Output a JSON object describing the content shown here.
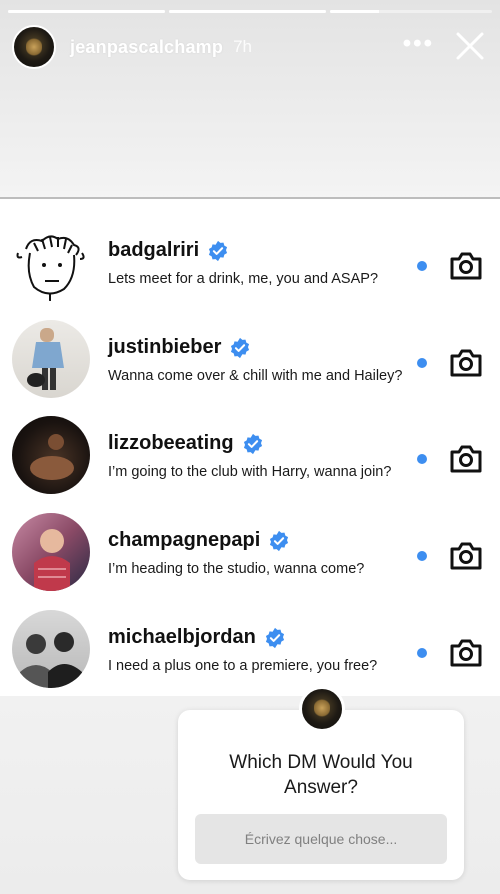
{
  "story": {
    "progress": [
      1.0,
      1.0,
      0.3
    ],
    "username": "jeanpascalchamp",
    "time": "7h",
    "more_label": "•••"
  },
  "dms": [
    {
      "username": "badgalriri",
      "verified": true,
      "message": "Lets meet for a drink, me, you and ASAP?",
      "unread": true,
      "avatar": "sketch-face"
    },
    {
      "username": "justinbieber",
      "verified": true,
      "message": "Wanna come over & chill with me and Hailey?",
      "unread": true,
      "avatar": "photo"
    },
    {
      "username": "lizzobeeating",
      "verified": true,
      "message": "I’m going to the club with Harry, wanna join?",
      "unread": true,
      "avatar": "photo"
    },
    {
      "username": "champagnepapi",
      "verified": true,
      "message": "I’m heading to the studio, wanna come?",
      "unread": true,
      "avatar": "photo"
    },
    {
      "username": "michaelbjordan",
      "verified": true,
      "message": "I need a plus one to a premiere, you free?",
      "unread": true,
      "avatar": "photo"
    }
  ],
  "question": {
    "text": "Which DM Would You Answer?",
    "placeholder": "Écrivez quelque chose..."
  },
  "colors": {
    "verified": "#3d8ef0",
    "unread_dot": "#3d8ef0",
    "input_bg": "#e5e5e5"
  },
  "icons": [
    "more-icon",
    "close-icon",
    "verified-badge-icon",
    "camera-icon"
  ]
}
